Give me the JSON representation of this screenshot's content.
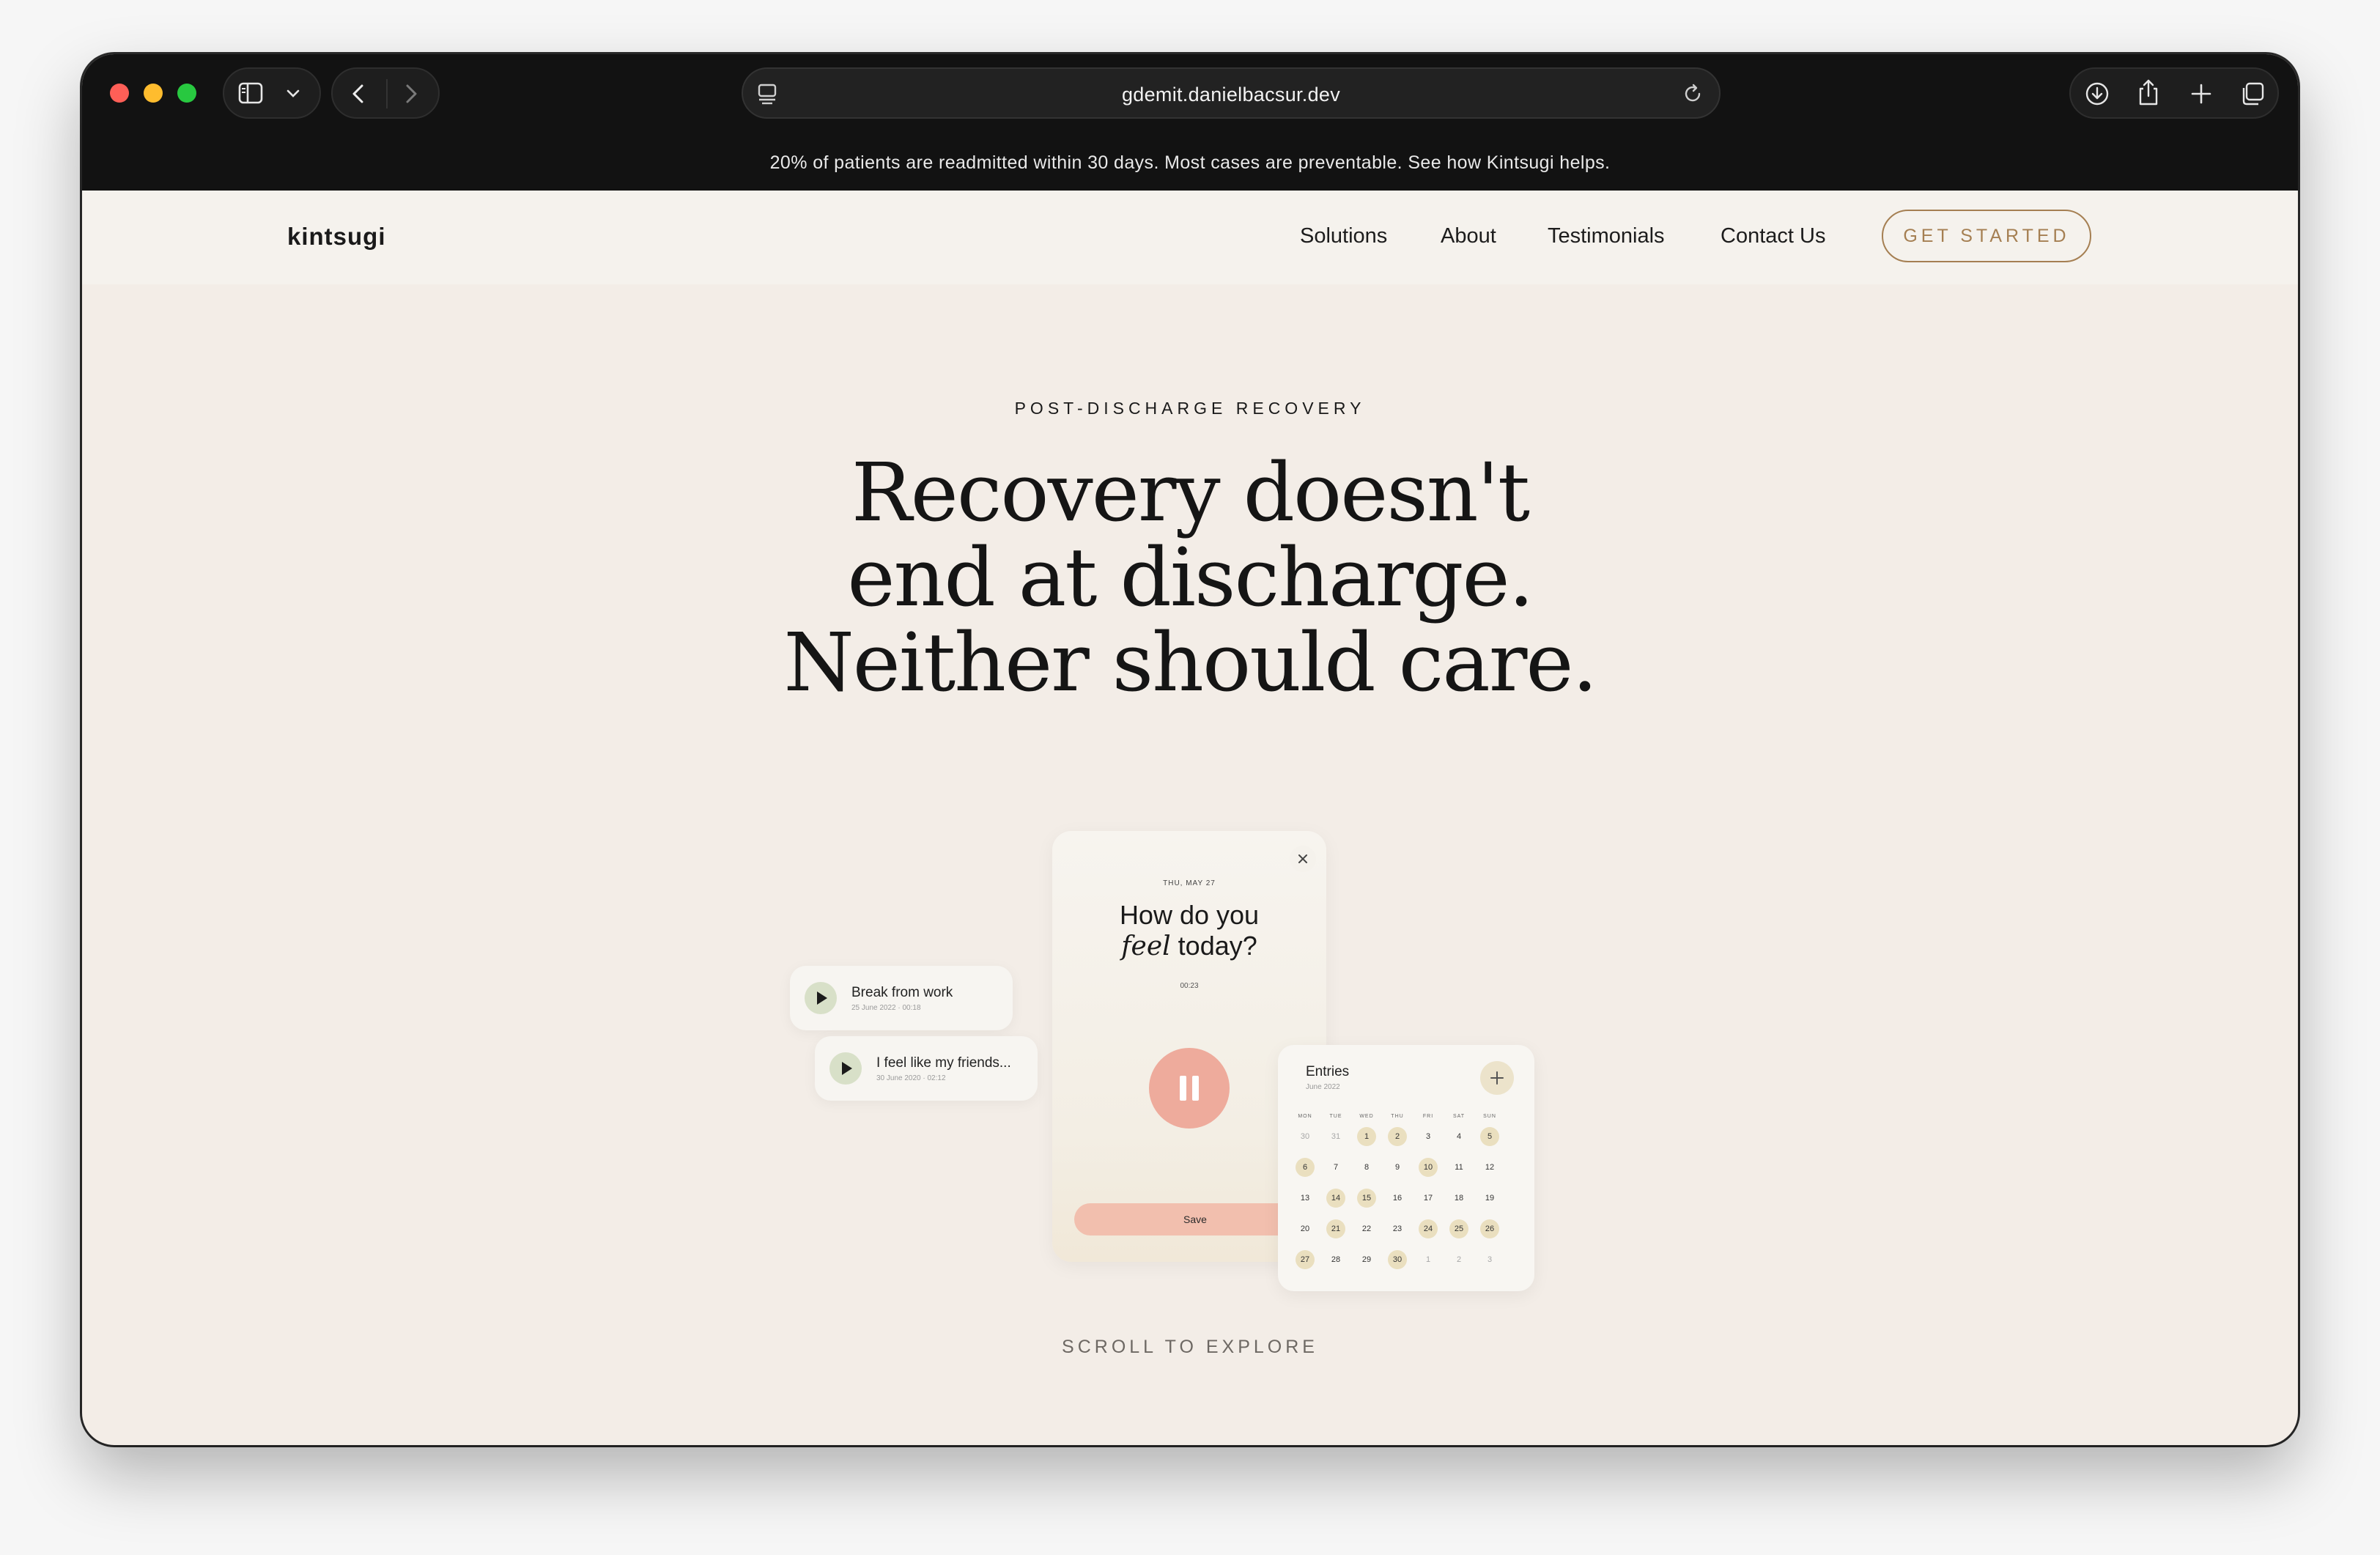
{
  "browser": {
    "url": "gdemit.danielbacsur.dev",
    "banner_text": "20% of patients are readmitted within 30 days. Most cases are preventable. See how Kintsugi helps.",
    "icons": [
      "sidebar-icon",
      "chevron-down-icon",
      "back-icon",
      "forward-icon",
      "site-settings-icon",
      "reload-icon",
      "download-icon",
      "share-icon",
      "new-tab-icon",
      "tab-overview-icon"
    ]
  },
  "nav": {
    "logo": "kintsugi",
    "links": [
      "Solutions",
      "About",
      "Testimonials",
      "Contact Us"
    ],
    "cta": "GET STARTED"
  },
  "hero": {
    "eyebrow": "POST-DISCHARGE RECOVERY",
    "headline": [
      "Recovery doesn't",
      "end at discharge.",
      "Neither should care."
    ],
    "scroll_hint": "SCROLL TO EXPLORE"
  },
  "mockup": {
    "recorder": {
      "date": "THU, MAY 27",
      "question_line1": "How do you",
      "question_italic": "feel",
      "question_rest": " today?",
      "timer": "00:23",
      "save_label": "Save"
    },
    "audio_entries": [
      {
        "title": "Break from work",
        "meta": "25 June 2022 · 00:18"
      },
      {
        "title": "I feel like my friends...",
        "meta": "30 June 2020 · 02:12"
      }
    ],
    "calendar": {
      "title": "Entries",
      "subtitle": "June 2022",
      "weekdays": [
        "MON",
        "TUE",
        "WED",
        "THU",
        "FRI",
        "SAT",
        "SUN"
      ],
      "weeks": [
        [
          "30",
          "31",
          "1",
          "2",
          "3",
          "4",
          "5"
        ],
        [
          "6",
          "7",
          "8",
          "9",
          "10",
          "11",
          "12"
        ],
        [
          "13",
          "14",
          "15",
          "16",
          "17",
          "18",
          "19"
        ],
        [
          "20",
          "21",
          "22",
          "23",
          "24",
          "25",
          "26"
        ],
        [
          "27",
          "28",
          "29",
          "30",
          "1",
          "2",
          "3"
        ]
      ],
      "highlighted": [
        "1",
        "2",
        "5",
        "6",
        "10",
        "14",
        "15",
        "21",
        "24",
        "25",
        "26",
        "27",
        "30"
      ]
    }
  },
  "colors": {
    "accent_gold": "#a57f52",
    "record_button": "#eeab9c",
    "save_button": "#f2bfae",
    "highlight_day": "#eadfbf",
    "page_background": "#f3ede7"
  }
}
